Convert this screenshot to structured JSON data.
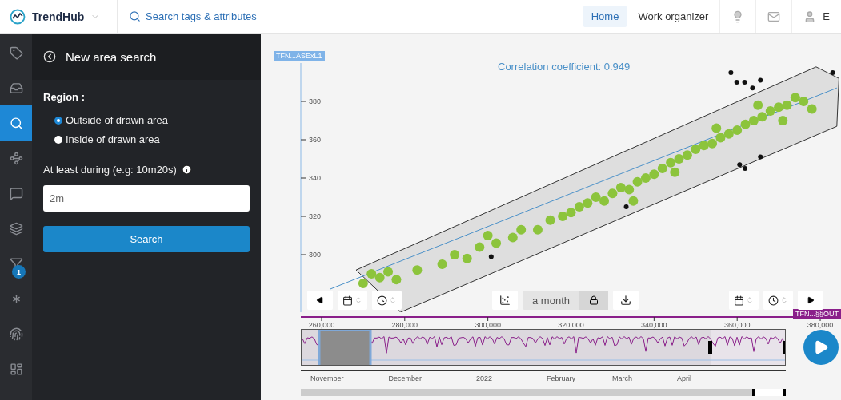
{
  "topbar": {
    "brand": "TrendHub",
    "search": {
      "placeholder": "Search tags & attributes"
    },
    "nav": [
      {
        "label": "Home",
        "selected": true
      },
      {
        "label": "Work organizer",
        "selected": false
      }
    ],
    "user": "E"
  },
  "rail": [
    {
      "selected": false
    },
    {
      "selected": false
    },
    {
      "selected": true
    },
    {
      "selected": false
    },
    {
      "selected": false
    },
    {
      "selected": false
    },
    {
      "selected": false,
      "badge": "1"
    },
    {
      "selected": false
    },
    {
      "selected": false
    },
    {
      "selected": false
    }
  ],
  "panel": {
    "title": "New area search",
    "region_label": "Region :",
    "options": [
      {
        "label": "Outside of drawn area",
        "selected": true
      },
      {
        "label": "Inside of drawn area",
        "selected": false
      }
    ],
    "duration_label": "At least during (e.g: 10m20s)",
    "duration": {
      "value": "2m"
    },
    "button": "Search"
  },
  "chart": {
    "chart_data": {
      "type": "scatter",
      "title": "Correlation coefficient: 0.949",
      "ylabel": "TFN...ASExL1",
      "xlabel": "TFN...§§OUT",
      "xlim": [
        255000,
        385000
      ],
      "ylim": [
        270,
        400
      ],
      "xticks": [
        {
          "value": 260000,
          "label": "260,000"
        },
        {
          "value": 280000,
          "label": "280,000"
        },
        {
          "value": 300000,
          "label": "300,000"
        },
        {
          "value": 320000,
          "label": "320,000"
        },
        {
          "value": 340000,
          "label": "340,000"
        },
        {
          "value": 360000,
          "label": "360,000"
        },
        {
          "value": 380000,
          "label": "380,000"
        }
      ],
      "yticks": [
        {
          "value": 300,
          "label": "300"
        },
        {
          "value": 320,
          "label": "320"
        },
        {
          "value": 340,
          "label": "340"
        },
        {
          "value": 360,
          "label": "360"
        },
        {
          "value": 380,
          "label": "380"
        }
      ],
      "x": [
        270000,
        272000,
        274000,
        276000,
        278000,
        283000,
        289000,
        292000,
        295000,
        298000,
        300000,
        302000,
        306000,
        308000,
        312000,
        315000,
        318000,
        320000,
        322000,
        324000,
        326000,
        328000,
        330000,
        332000,
        334000,
        335000,
        336000,
        338000,
        340000,
        342000,
        344000,
        345000,
        346000,
        348000,
        350000,
        352000,
        354000,
        355000,
        356000,
        358000,
        360000,
        362000,
        364000,
        365000,
        366000,
        368000,
        370000,
        371000,
        372000,
        374000,
        376000,
        378000,
        300800,
        333300,
        360600,
        361900,
        365600,
        358500,
        359900,
        361800,
        365600,
        363700,
        383000
      ],
      "series": [
        {
          "color": "#8cc43c",
          "values": [
            285,
            290,
            288,
            291,
            287,
            292,
            295,
            300,
            298,
            304,
            310,
            306,
            309,
            313,
            313,
            318,
            320,
            322,
            325,
            327,
            330,
            328,
            332,
            335,
            334,
            328,
            338,
            340,
            342,
            345,
            348,
            343,
            350,
            352,
            355,
            357,
            358,
            366,
            361,
            363,
            365,
            368,
            370,
            378,
            372,
            375,
            377,
            370,
            378,
            382,
            380,
            376,
            null,
            null,
            null,
            null,
            null,
            null,
            null,
            null,
            null,
            null,
            null
          ]
        },
        {
          "color": "#111111",
          "values": [
            null,
            null,
            null,
            null,
            null,
            null,
            null,
            null,
            null,
            null,
            null,
            null,
            null,
            null,
            null,
            null,
            null,
            null,
            null,
            null,
            null,
            null,
            null,
            null,
            null,
            null,
            null,
            null,
            null,
            null,
            null,
            null,
            null,
            null,
            null,
            null,
            null,
            null,
            null,
            null,
            null,
            null,
            null,
            null,
            null,
            null,
            null,
            null,
            null,
            null,
            null,
            null,
            299,
            325,
            347,
            345,
            351,
            395,
            390,
            390,
            391,
            387,
            395
          ]
        }
      ]
    },
    "toolbar": {
      "period": "a month"
    },
    "timeline": {
      "months": [
        "November",
        "December",
        "2022",
        "February",
        "March",
        "April"
      ]
    }
  }
}
